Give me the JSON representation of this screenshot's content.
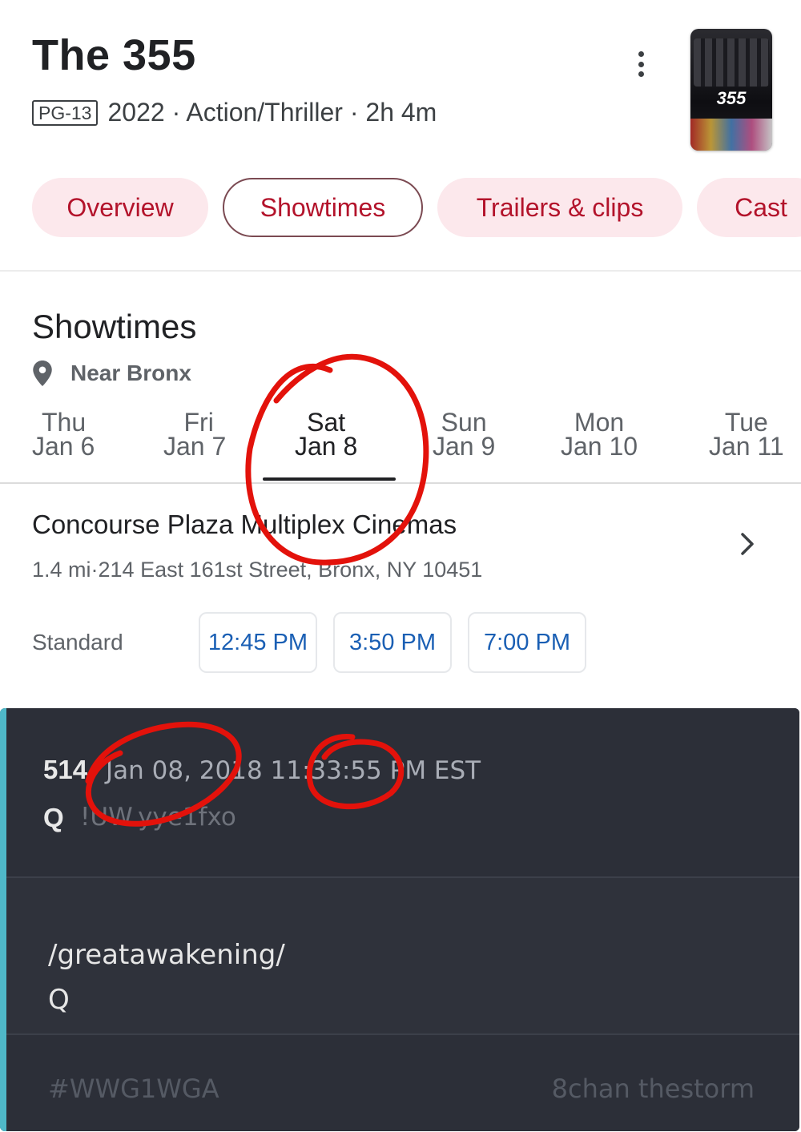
{
  "movie": {
    "title": "The 355",
    "rating": "PG-13",
    "info": "2022 · Action/Thriller · 2h 4m",
    "poster_text": "355"
  },
  "tabs": [
    {
      "label": "Overview",
      "selected": false
    },
    {
      "label": "Showtimes",
      "selected": true
    },
    {
      "label": "Trailers & clips",
      "selected": false
    },
    {
      "label": "Cast",
      "selected": false
    }
  ],
  "showtimes": {
    "heading": "Showtimes",
    "location": "Near Bronx",
    "days": [
      {
        "name": "Thu",
        "date": "Jan 6"
      },
      {
        "name": "Fri",
        "date": "Jan 7"
      },
      {
        "name": "Sat",
        "date": "Jan 8",
        "selected": true
      },
      {
        "name": "Sun",
        "date": "Jan 9"
      },
      {
        "name": "Mon",
        "date": "Jan 10"
      },
      {
        "name": "Tue",
        "date": "Jan 11"
      }
    ],
    "theater": {
      "name": "Concourse Plaza Multiplex Cinemas",
      "address": "1.4 mi·214 East 161st Street, Bronx, NY 10451",
      "format": "Standard",
      "times": [
        "12:45 PM",
        "3:50 PM",
        "7:00 PM"
      ]
    }
  },
  "post": {
    "number": "514",
    "datetime": "Jan 08, 2018 11:33:55 PM EST",
    "author": "Q",
    "tripcode": "!UW.yye1fxo",
    "board": "/greatawakening/",
    "signature": "Q",
    "hashtag": "#WWG1WGA",
    "source": "8chan thestorm"
  },
  "colors": {
    "tab_text": "#b3132b",
    "tab_bg": "#fce8ec",
    "time_text": "#1a5fb4",
    "card_bg": "#2c2f38",
    "accent_bar": "#4fb8c8",
    "annotation_red": "#e3120b"
  }
}
